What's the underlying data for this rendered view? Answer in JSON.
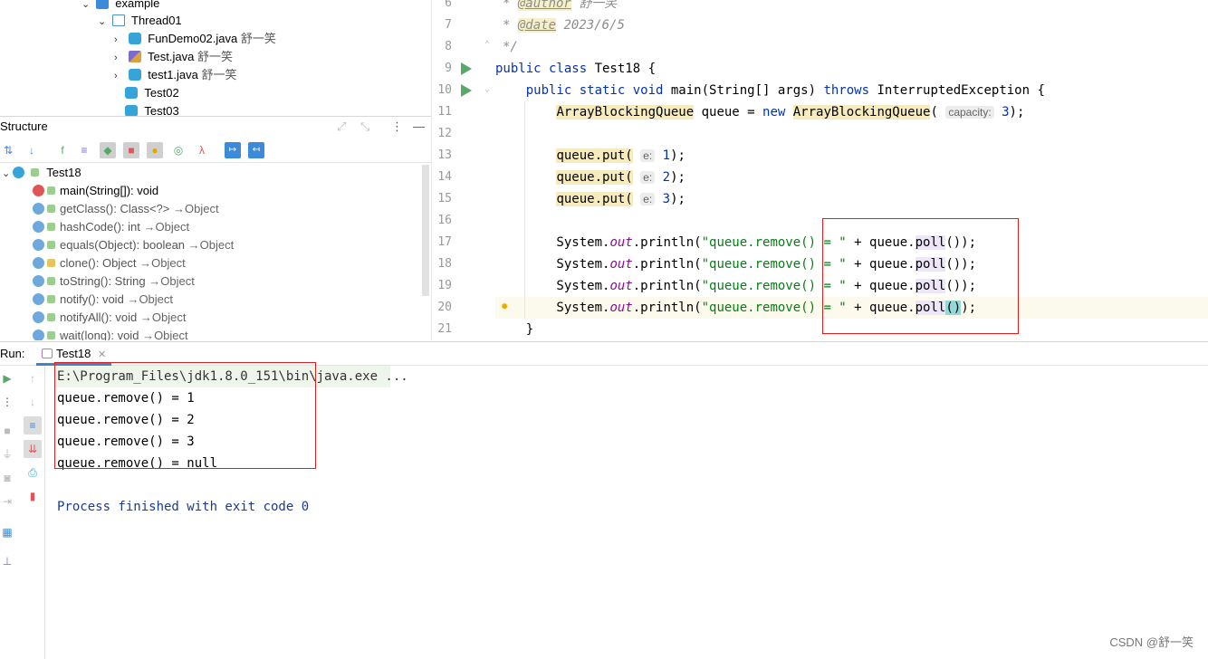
{
  "project_tree": {
    "rows": [
      {
        "label": "example",
        "vcs": ""
      },
      {
        "label": "Thread01",
        "vcs": ""
      },
      {
        "label": "FunDemo02.java",
        "vcs": "舒一笑"
      },
      {
        "label": "Test.java",
        "vcs": "舒一笑"
      },
      {
        "label": "test1.java",
        "vcs": "舒一笑"
      },
      {
        "label": "Test02",
        "vcs": ""
      },
      {
        "label": "Test03",
        "vcs": ""
      }
    ]
  },
  "structure": {
    "title": "Structure",
    "root": "Test18",
    "members": [
      {
        "name": "main(String[]): void",
        "inherited": ""
      },
      {
        "name": "getClass(): Class<?>",
        "inherited": "→Object"
      },
      {
        "name": "hashCode(): int",
        "inherited": "→Object"
      },
      {
        "name": "equals(Object): boolean",
        "inherited": "→Object"
      },
      {
        "name": "clone(): Object",
        "inherited": "→Object"
      },
      {
        "name": "toString(): String",
        "inherited": "→Object"
      },
      {
        "name": "notify(): void",
        "inherited": "→Object"
      },
      {
        "name": "notifyAll(): void",
        "inherited": "→Object"
      },
      {
        "name": "wait(long): void",
        "inherited": "→Object"
      }
    ]
  },
  "editor": {
    "line_numbers": [
      "6",
      "7",
      "8",
      "9",
      "10",
      "11",
      "12",
      "13",
      "14",
      "15",
      "16",
      "17",
      "18",
      "19",
      "20",
      "21"
    ],
    "comment_author_tag": "@author",
    "comment_author_value": "舒一笑",
    "comment_date_tag": "@date",
    "comment_date_value": "2023/6/5",
    "class_name": "Test18",
    "param_hint_capacity": "capacity:",
    "param_hint_e": "e:",
    "string_literal": "\"queue.remove() = \""
  },
  "run": {
    "label": "Run:",
    "tab": "Test18",
    "console_lines": [
      "E:\\Program_Files\\jdk1.8.0_151\\bin\\java.exe ...",
      "queue.remove() = 1",
      "queue.remove() = 2",
      "queue.remove() = 3",
      "queue.remove() = null",
      "",
      "Process finished with exit code 0"
    ]
  },
  "watermark": "CSDN @舒一笑",
  "colors": {
    "keyword": "#0033b3",
    "string": "#067d17",
    "annotation_box": "#e02020",
    "run_green": "#59a869"
  }
}
